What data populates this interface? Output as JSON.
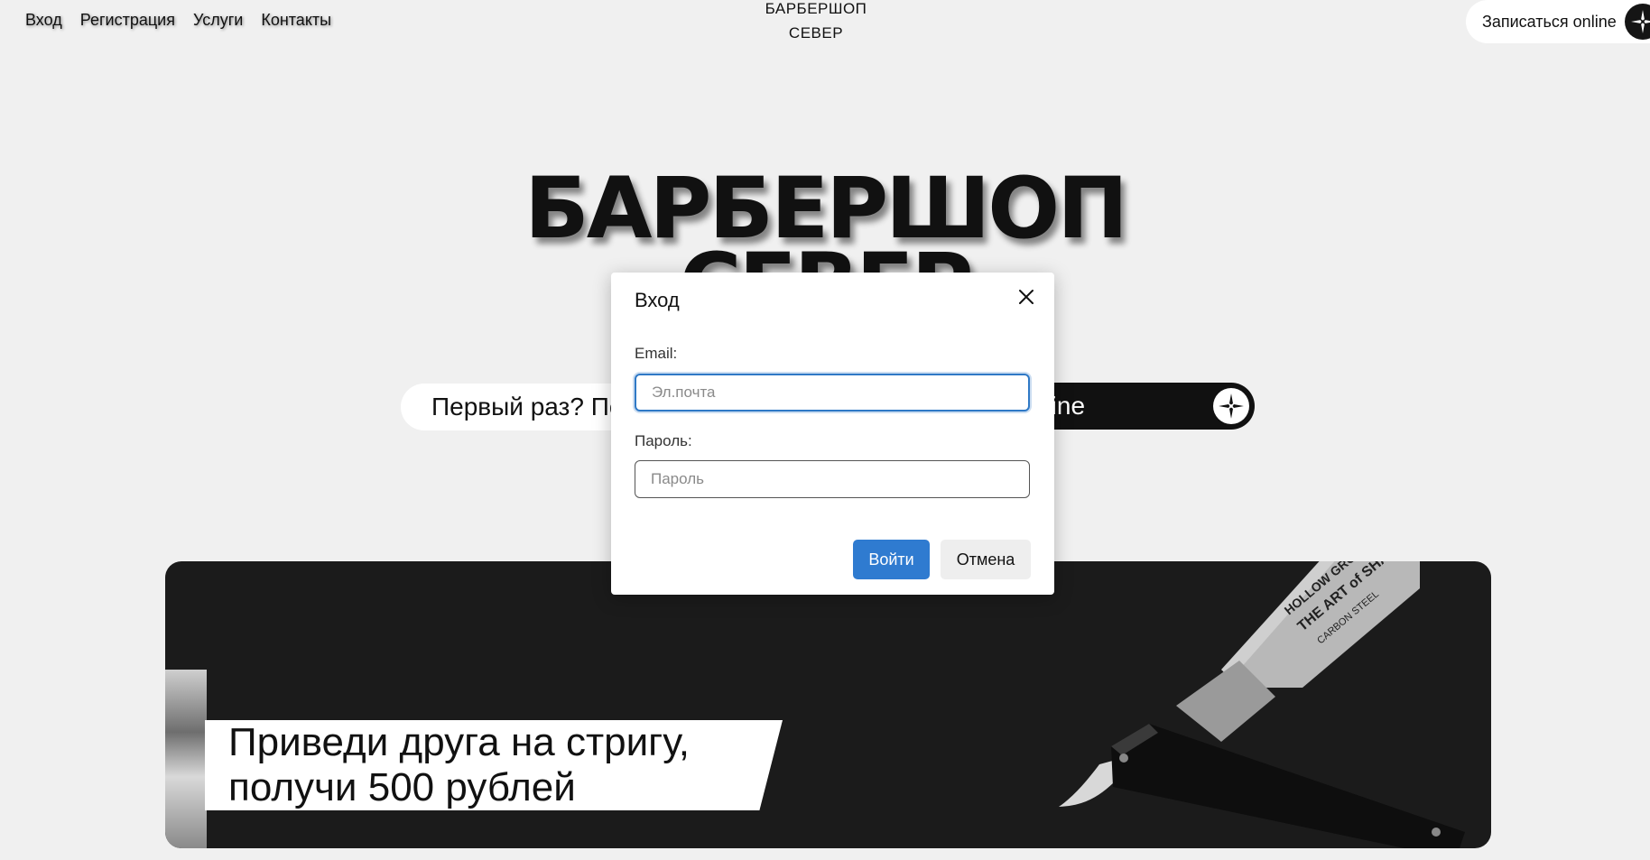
{
  "nav": {
    "items": [
      {
        "label": "Вход"
      },
      {
        "label": "Регистрация"
      },
      {
        "label": "Услуги"
      },
      {
        "label": "Контакты"
      }
    ]
  },
  "brand": {
    "line1": "БАРБЕРШОП",
    "line2": "СЕВЕР"
  },
  "header": {
    "book_label": "Записаться online",
    "book_icon": "compass-icon"
  },
  "hero": {
    "title_line1": "БАРБЕРШОП",
    "title_line2": "СЕВЕР",
    "first_time_label": "Первый раз? Пе",
    "book_label": "аться online"
  },
  "banner": {
    "promo_line1": "Приведи друга на стригу,",
    "promo_line2": "получи 500 рублей",
    "razor_text1": "HOLLOW GROUND",
    "razor_text2": "THE ART of SHAVING",
    "razor_text3": "CARBON STEEL"
  },
  "modal": {
    "title": "Вход",
    "email_label": "Email:",
    "email_placeholder": "Эл.почта",
    "password_label": "Пароль:",
    "password_placeholder": "Пароль",
    "submit_label": "Войти",
    "cancel_label": "Отмена"
  },
  "colors": {
    "accent": "#2f7bd0",
    "background": "#f0f0f0",
    "banner": "#1b1b1b"
  }
}
